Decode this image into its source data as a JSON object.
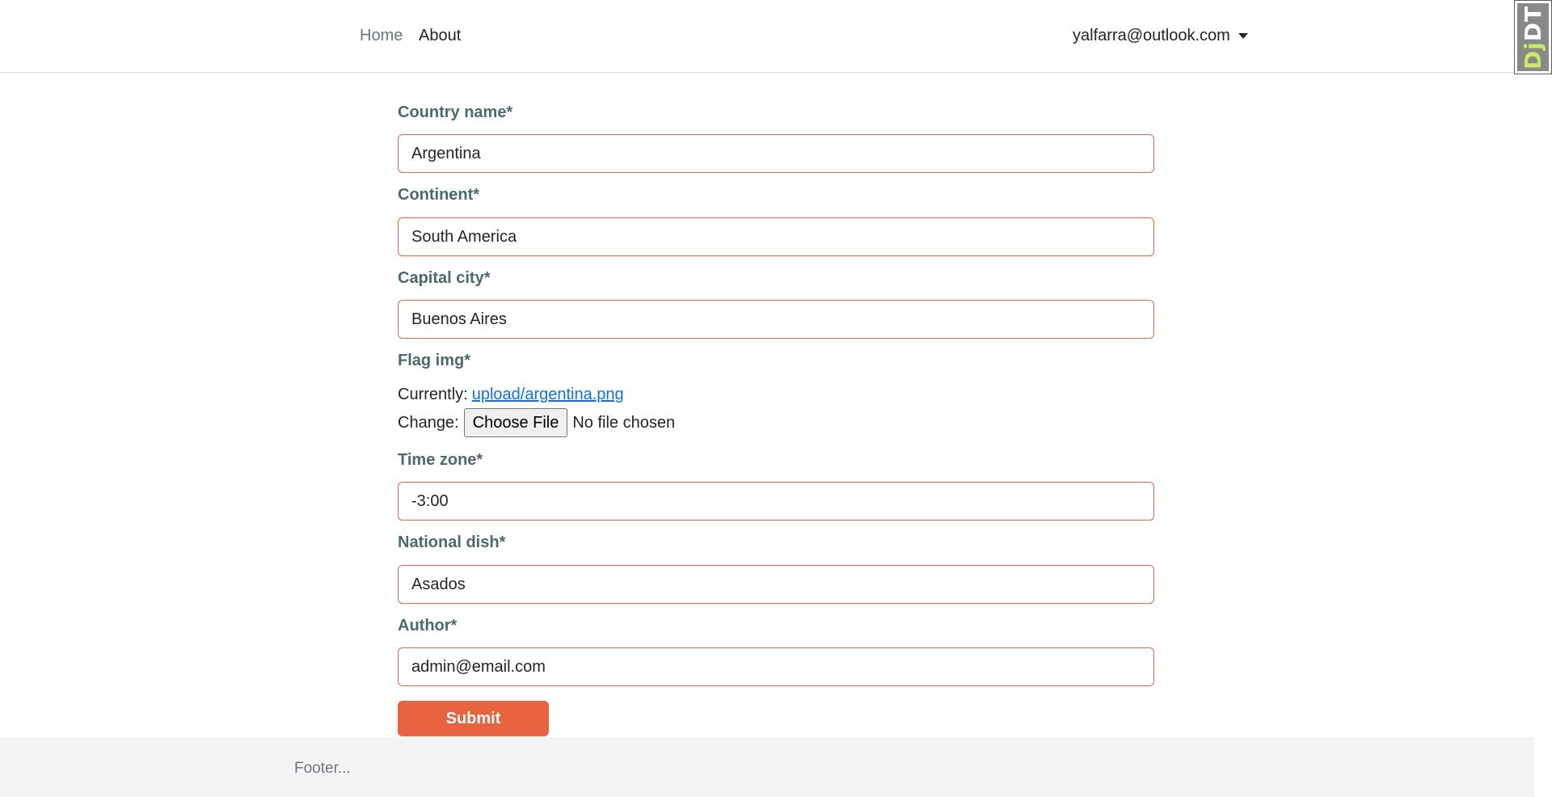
{
  "nav": {
    "home": "Home",
    "about": "About",
    "user_email": "yalfarra@outlook.com"
  },
  "debug_toolbar": {
    "label_dj": "Dj",
    "label_dt": "DT"
  },
  "form": {
    "country_name": {
      "label": "Country name*",
      "value": "Argentina"
    },
    "continent": {
      "label": "Continent*",
      "value": "South America"
    },
    "capital_city": {
      "label": "Capital city*",
      "value": "Buenos Aires"
    },
    "flag_img": {
      "label": "Flag img*",
      "currently_label": "Currently:",
      "current_file": "upload/argentina.png",
      "change_label": "Change:",
      "choose_button": "Choose File",
      "no_file": "No file chosen"
    },
    "time_zone": {
      "label": "Time zone*",
      "value": "-3:00"
    },
    "national_dish": {
      "label": "National dish*",
      "value": "Asados"
    },
    "author": {
      "label": "Author*",
      "value": "admin@email.com"
    },
    "submit": "Submit"
  },
  "footer": {
    "text": "Footer..."
  },
  "colors": {
    "accent": "#e8643f",
    "input_border": "#e8664a",
    "label": "#4a6b6b",
    "link": "#0d6efd"
  }
}
